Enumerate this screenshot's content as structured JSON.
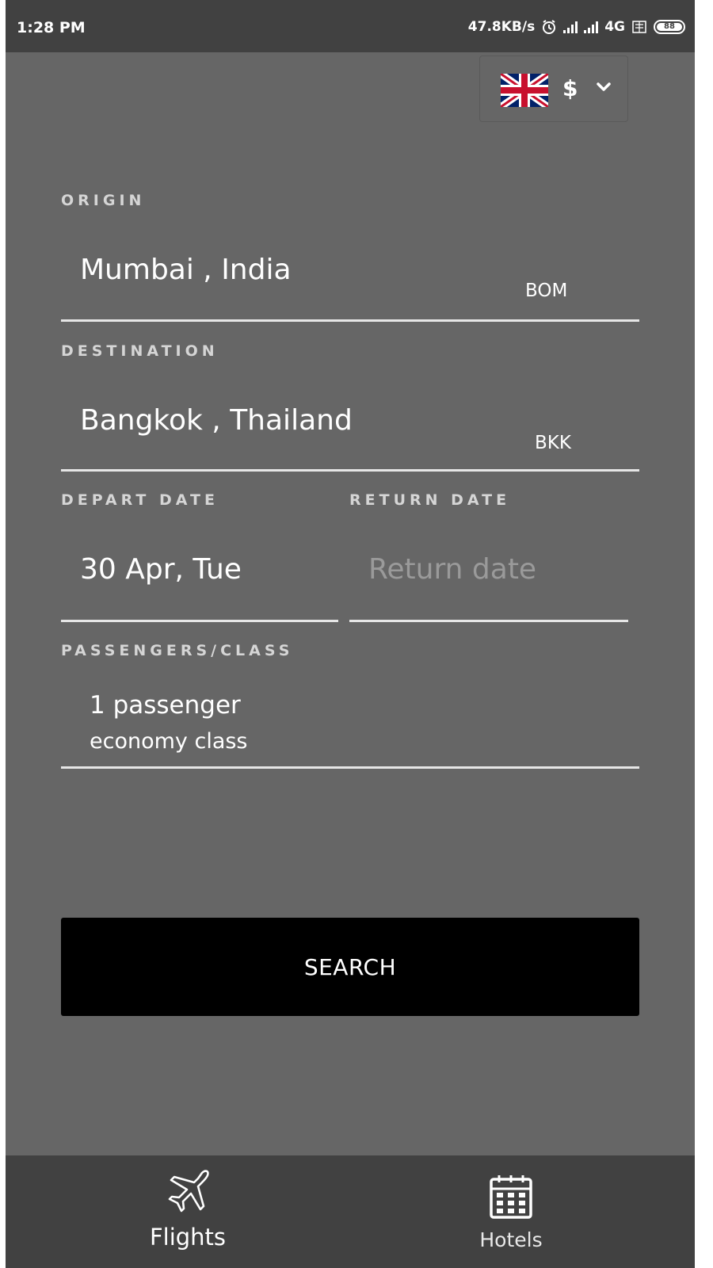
{
  "status_bar": {
    "time": "1:28 PM",
    "net_speed": "47.8KB/s",
    "network_type": "4G",
    "battery_level": "88"
  },
  "currency": {
    "symbol": "$",
    "flag": "uk-flag-icon"
  },
  "form": {
    "origin": {
      "label": "ORIGIN",
      "value": "Mumbai , India",
      "code": "BOM"
    },
    "destination": {
      "label": "DESTINATION",
      "value": "Bangkok , Thailand",
      "code": "BKK"
    },
    "depart_date": {
      "label": "DEPART DATE",
      "value": "30 Apr, Tue"
    },
    "return_date": {
      "label": "RETURN DATE",
      "placeholder": "Return date"
    },
    "passengers": {
      "label": "PASSENGERS/CLASS",
      "count": "1 passenger",
      "class": "economy class"
    }
  },
  "search_button": {
    "label": "SEARCH"
  },
  "bottom_nav": {
    "items": [
      {
        "label": "Flights",
        "icon": "airplane-icon",
        "active": true
      },
      {
        "label": "Hotels",
        "icon": "calendar-icon",
        "active": false
      }
    ]
  },
  "colors": {
    "background": "#666666",
    "status_bar": "#414141",
    "bottom_nav": "#414141",
    "button": "#000000",
    "underline": "#e6e6e6"
  }
}
